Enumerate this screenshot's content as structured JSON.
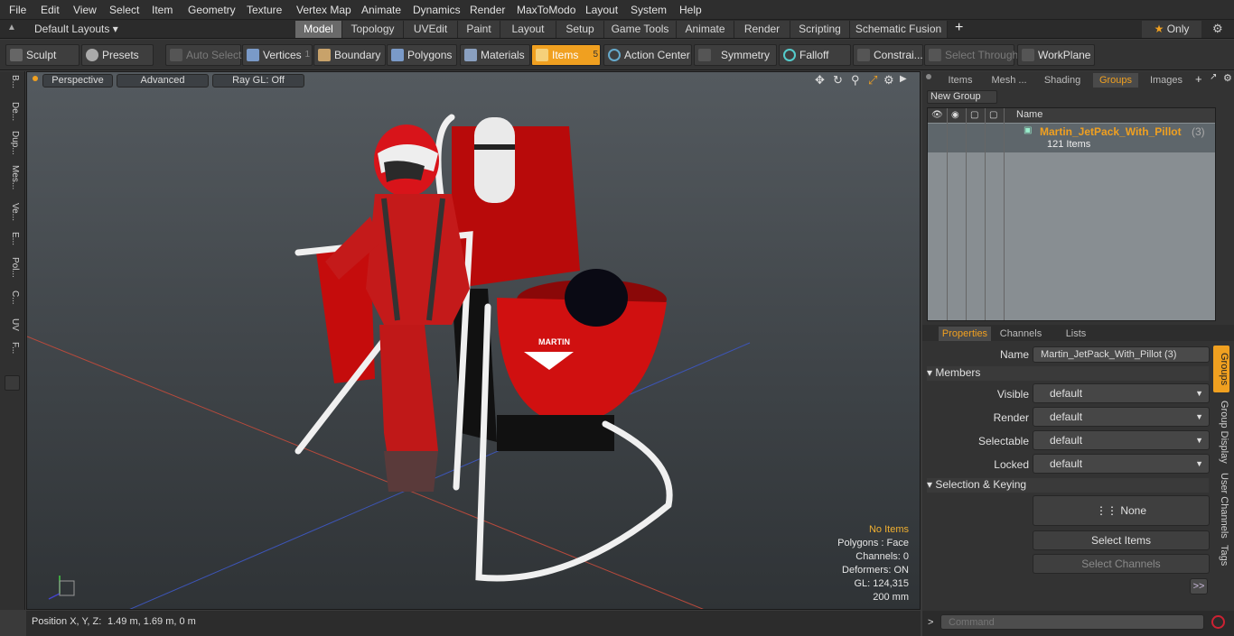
{
  "menu": [
    "File",
    "Edit",
    "View",
    "Select",
    "Item",
    "Geometry",
    "Texture",
    "Vertex Map",
    "Animate",
    "Dynamics",
    "Render",
    "MaxToModo",
    "Layout",
    "System",
    "Help"
  ],
  "layout": {
    "preset": "Default Layouts",
    "tabs": [
      "Model",
      "Topology",
      "UVEdit",
      "Paint",
      "Layout",
      "Setup",
      "Game Tools",
      "Animate",
      "Render",
      "Scripting",
      "Schematic Fusion"
    ],
    "active_tab": "Model",
    "only_label": "Only"
  },
  "toolbar": {
    "sculpt": "Sculpt",
    "presets": "Presets",
    "auto_select": "Auto Select",
    "vertices": "Vertices",
    "vertices_count": "1",
    "boundary": "Boundary",
    "polygons": "Polygons",
    "materials": "Materials",
    "items": "Items",
    "items_count": "5",
    "action_center": "Action Center",
    "symmetry": "Symmetry",
    "falloff": "Falloff",
    "constraints": "Constrai...",
    "select_through": "Select Through",
    "workplane": "WorkPlane"
  },
  "left_tabs": [
    "B...",
    "De...",
    "Dup...",
    "Mes...",
    "Ve...",
    "E...",
    "Pol...",
    "C...",
    "UV",
    "F..."
  ],
  "viewport": {
    "view": "Perspective",
    "shading": "Advanced",
    "raygl": "Ray GL: Off",
    "stats": {
      "no_items": "No Items",
      "polygons": "Polygons : Face",
      "channels": "Channels: 0",
      "deformers": "Deformers: ON",
      "gl": "GL: 124,315",
      "scale": "200 mm"
    },
    "model_text": "MARTIN"
  },
  "status": {
    "position_label": "Position X, Y, Z:",
    "position_value": "1.49 m, 1.69 m, 0 m"
  },
  "right_panel": {
    "tabs": [
      "Items",
      "Mesh ...",
      "Shading",
      "Groups",
      "Images"
    ],
    "active_tab": "Groups",
    "new_group": "New Group",
    "name_col": "Name",
    "group": {
      "name": "Martin_JetPack_With_Pillot",
      "count": "(3)",
      "items": "121 Items"
    },
    "prop_tabs": [
      "Properties",
      "Channels",
      "Lists"
    ],
    "name_label": "Name",
    "name_value": "Martin_JetPack_With_Pillot (3)",
    "members": "Members",
    "visible_label": "Visible",
    "render_label": "Render",
    "selectable_label": "Selectable",
    "locked_label": "Locked",
    "default": "default",
    "sel_keying": "Selection & Keying",
    "none": "None",
    "select_items": "Select Items",
    "select_channels": "Select Channels",
    "more": ">>",
    "vertical_tabs": [
      "Groups",
      "Group Display",
      "User Channels",
      "Tags"
    ],
    "command_placeholder": "Command"
  },
  "colors": {
    "accent": "#f0a020",
    "jetpack_red": "#d01010"
  }
}
